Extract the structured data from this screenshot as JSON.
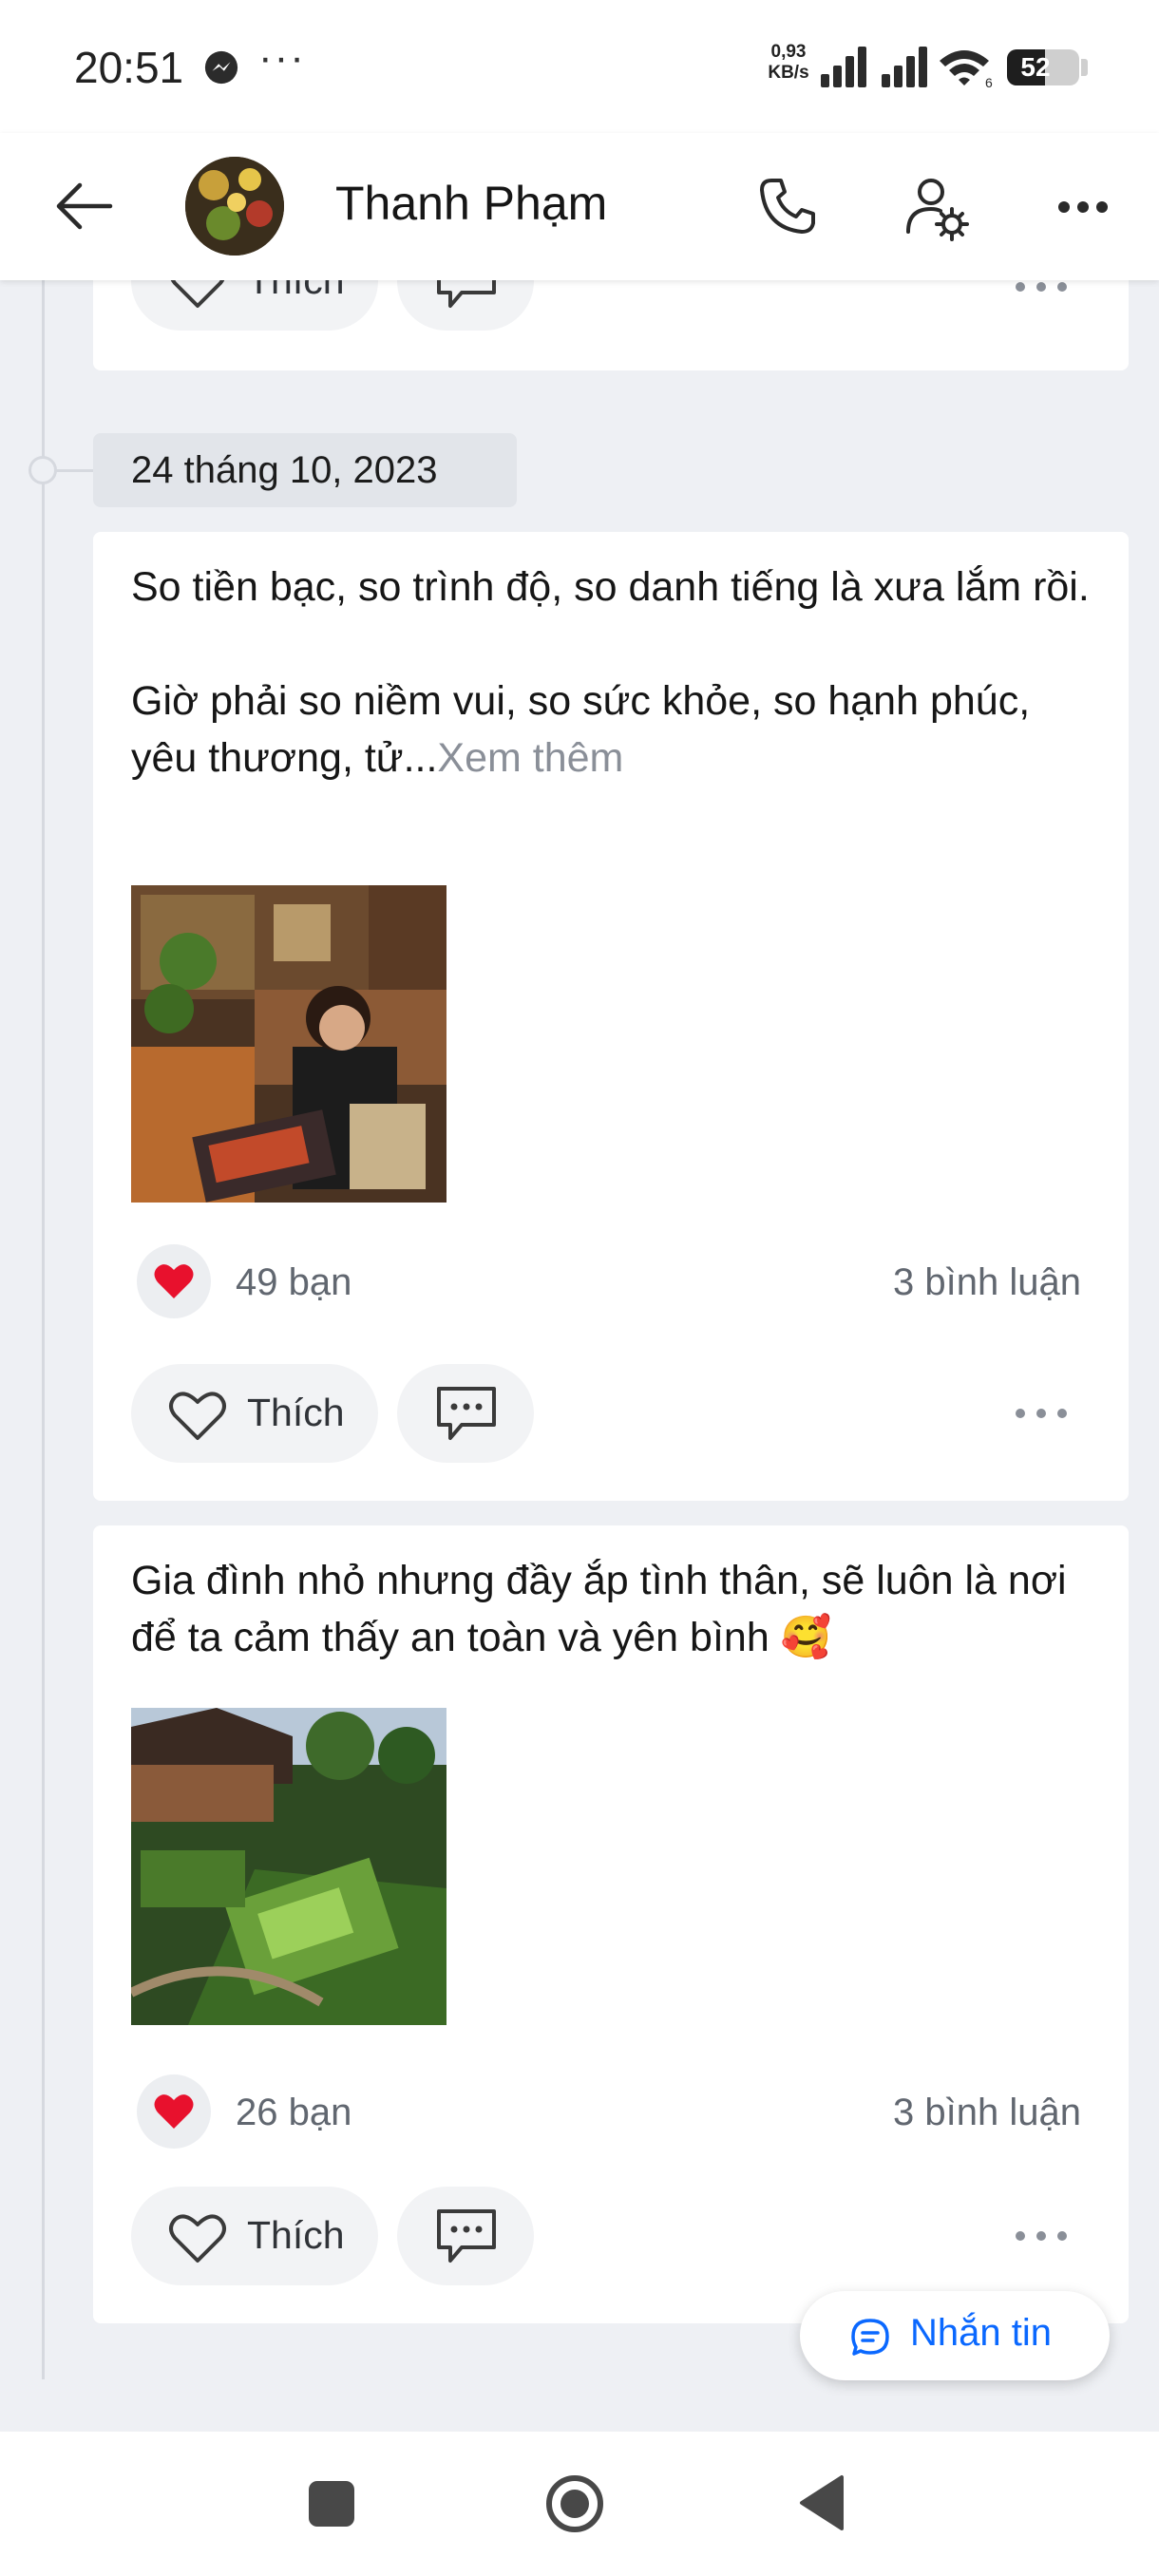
{
  "status_bar": {
    "time": "20:51",
    "net_speed_value": "0,93",
    "net_speed_unit": "KB/s",
    "wifi_label": "6",
    "battery_percent": "52",
    "battery_level": 0.52
  },
  "header": {
    "name": "Thanh Phạm"
  },
  "previous_post": {
    "like_label": "Thích"
  },
  "date_separator": "24 tháng 10, 2023",
  "posts": [
    {
      "text_line1": "So tiền bạc, so trình độ, so danh tiếng là xưa lắm rồi.",
      "text_line2": "Giờ phải so niềm vui, so sức khỏe, so hạnh phúc, yêu thương, tử...",
      "see_more": "Xem thêm",
      "reactions": "49 bạn",
      "comments": "3 bình luận",
      "like_label": "Thích"
    },
    {
      "text": "Gia đình nhỏ nhưng đầy ắp tình thân, sẽ luôn là nơi để ta cảm thấy an toàn và yên bình 🥰",
      "reactions": "26 bạn",
      "comments": "3 bình luận",
      "like_label": "Thích"
    }
  ],
  "message_button": "Nhắn tin",
  "colors": {
    "accent": "#0a68ff",
    "heart": "#e8112d",
    "background": "#eef0f4"
  },
  "icons": [
    "messenger-icon",
    "signal-icon",
    "wifi-icon",
    "battery-icon",
    "back-icon",
    "call-icon",
    "profile-settings-icon",
    "more-icon",
    "heart-icon",
    "comment-icon",
    "chat-icon"
  ]
}
